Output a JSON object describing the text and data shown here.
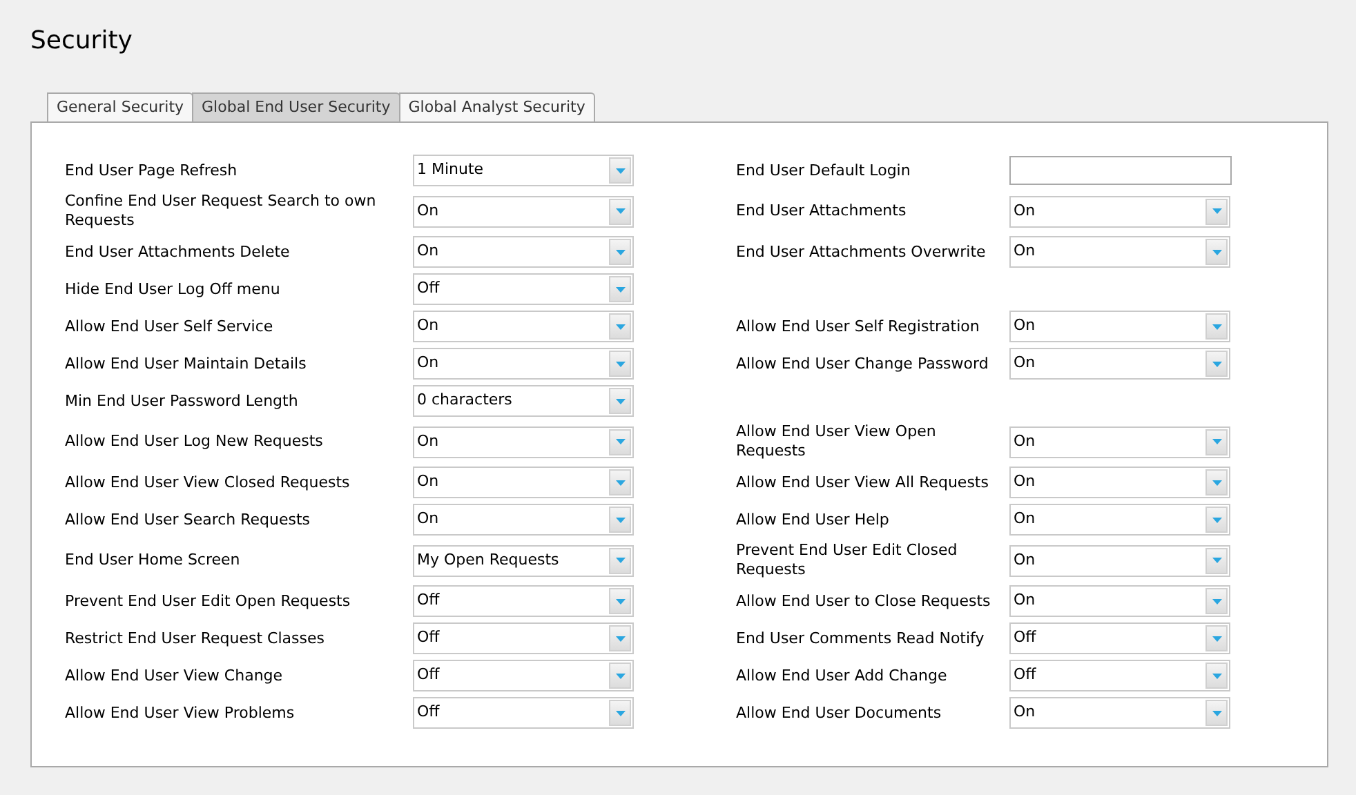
{
  "title": "Security",
  "tabs": [
    {
      "label": "General Security",
      "selected": false
    },
    {
      "label": "Global End User Security",
      "selected": true
    },
    {
      "label": "Global Analyst Security",
      "selected": false
    }
  ],
  "rows": [
    {
      "left": {
        "label": "End User Page Refresh",
        "value": "1 Minute"
      },
      "right": {
        "label": "End User Default Login",
        "kind": "text"
      }
    },
    {
      "left": {
        "label": "Confine End User Request Search to own Requests",
        "value": "On"
      },
      "right": {
        "label": "End User Attachments",
        "kind": "select",
        "value": "On"
      }
    },
    {
      "left": {
        "label": "End User Attachments Delete",
        "value": "On"
      },
      "right": {
        "label": "End User Attachments Overwrite",
        "kind": "select",
        "value": "On"
      }
    },
    {
      "left": {
        "label": "Hide End User Log Off menu",
        "value": "Off"
      }
    },
    {
      "left": {
        "label": "Allow End User Self Service",
        "value": "On"
      },
      "right": {
        "label": "Allow End User Self Registration",
        "kind": "select",
        "value": "On"
      }
    },
    {
      "left": {
        "label": "Allow End User Maintain Details",
        "value": "On"
      },
      "right": {
        "label": "Allow End User Change Password",
        "kind": "select",
        "value": "On"
      }
    },
    {
      "left": {
        "label": "Min End User Password Length",
        "value": "0 characters"
      }
    },
    {
      "left": {
        "label": "Allow End User Log New Requests",
        "value": "On"
      },
      "right": {
        "label": "Allow End User View Open Requests",
        "kind": "select",
        "value": "On"
      }
    },
    {
      "left": {
        "label": "Allow End User View Closed Requests",
        "value": "On"
      },
      "right": {
        "label": "Allow End User View All Requests",
        "kind": "select",
        "value": "On"
      }
    },
    {
      "left": {
        "label": "Allow End User Search Requests",
        "value": "On"
      },
      "right": {
        "label": "Allow End User Help",
        "kind": "select",
        "value": "On"
      }
    },
    {
      "left": {
        "label": "End User Home Screen",
        "value": "My Open Requests"
      },
      "right": {
        "label": "Prevent End User Edit Closed Requests",
        "kind": "select",
        "value": "On"
      }
    },
    {
      "left": {
        "label": "Prevent End User Edit Open Requests",
        "value": "Off"
      },
      "right": {
        "label": "Allow End User to Close Requests",
        "kind": "select",
        "value": "On"
      }
    },
    {
      "left": {
        "label": "Restrict End User Request Classes",
        "value": "Off"
      },
      "right": {
        "label": "End User Comments Read Notify",
        "kind": "select",
        "value": "Off"
      }
    },
    {
      "left": {
        "label": "Allow End User View Change",
        "value": "Off"
      },
      "right": {
        "label": "Allow End User Add Change",
        "kind": "select",
        "value": "Off"
      }
    },
    {
      "left": {
        "label": "Allow End User View Problems",
        "value": "Off"
      },
      "right": {
        "label": "Allow End User Documents",
        "kind": "select",
        "value": "On"
      }
    }
  ]
}
